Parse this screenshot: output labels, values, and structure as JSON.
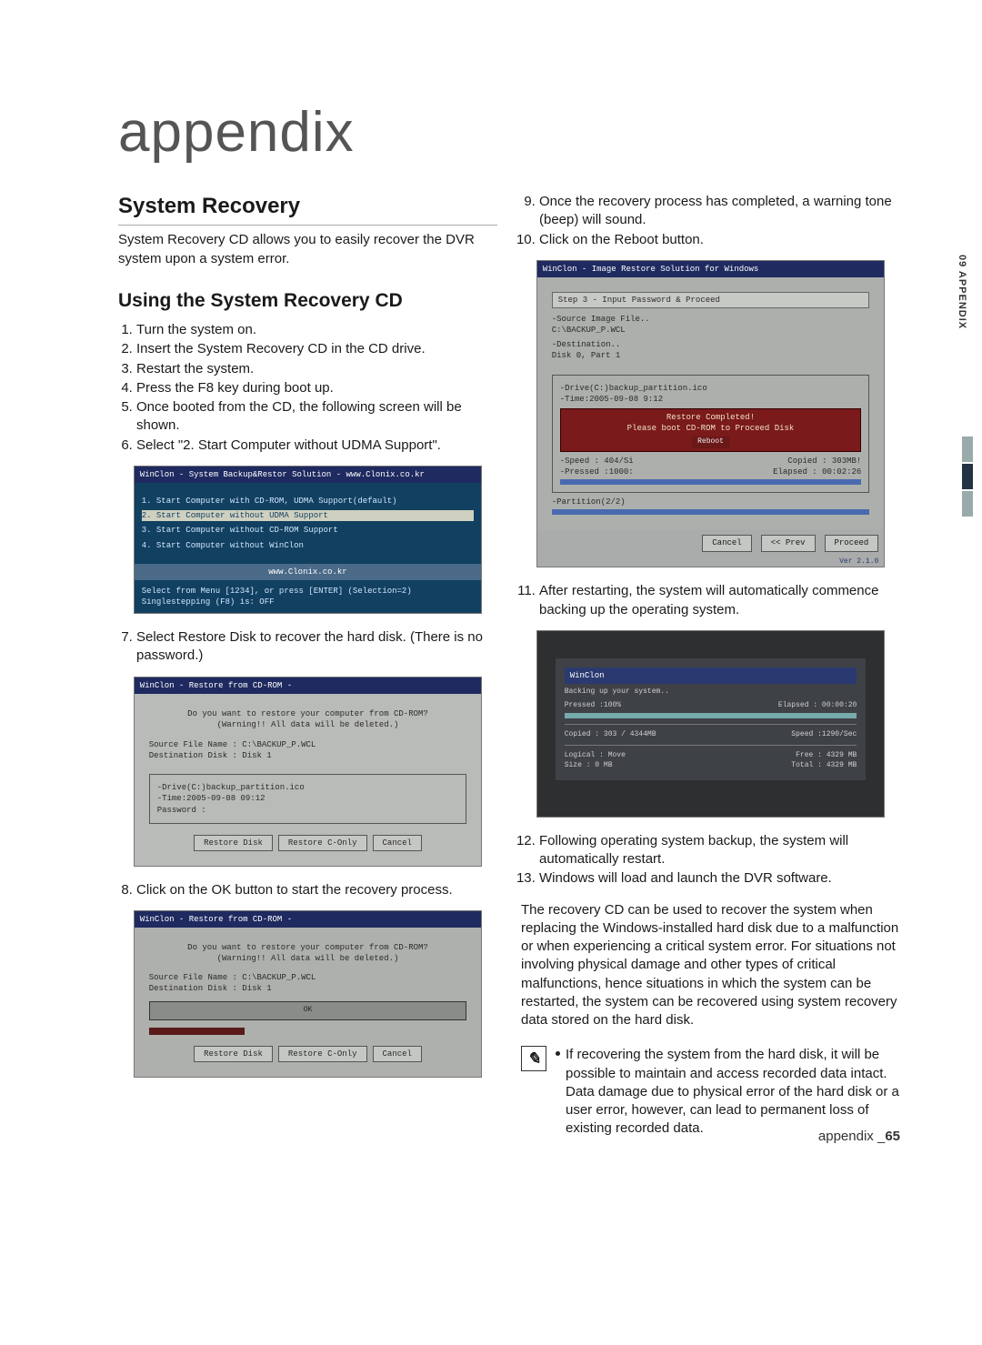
{
  "page": {
    "title": "appendix",
    "sidebar_label": "09 APPENDIX",
    "footer_word": "appendix _",
    "footer_page": "65"
  },
  "left": {
    "h_system_recovery": "System Recovery",
    "intro": "System Recovery CD allows you to easily recover the DVR system upon a system error.",
    "h_using": "Using the System Recovery CD",
    "steps_a": [
      "Turn the system on.",
      "Insert the System Recovery CD in the CD drive.",
      "Restart the system.",
      "Press the F8 key during boot up.",
      "Once booted from the CD, the following screen will be shown.",
      "Select \"2. Start Computer without UDMA Support\"."
    ],
    "shot1": {
      "title": "WinClon - System Backup&Restor Solution  -  www.Clonix.co.kr",
      "opts": [
        "1. Start Computer with CD-ROM, UDMA Support(default)",
        "2. Start Computer without UDMA Support",
        "3. Start Computer without CD-ROM Support",
        "4. Start Computer without WinClon"
      ],
      "url": "www.Clonix.co.kr",
      "sel1": "Select from Menu [1234], or press [ENTER] (Selection=2)",
      "sel2": "Singlestepping (F8) is: OFF"
    },
    "step7": "Select Restore Disk to recover the hard disk. (There is no password.)",
    "shot2": {
      "title": "WinClon - Restore from CD-ROM -",
      "msg1": "Do you want to restore your computer from CD-ROM?",
      "msg2": "(Warning!! All data will be deleted.)",
      "src": "Source File Name : C:\\BACKUP_P.WCL",
      "dst": "Destination Disk : Disk 1",
      "drv": "-Drive(C:)backup_partition.ico",
      "time": "-Time:2005-09-08 09:12",
      "pwd": "Password :",
      "btns": [
        "Restore Disk",
        "Restore C-Only",
        "Cancel"
      ]
    },
    "step8": "Click on the OK button to start the recovery process.",
    "shot3": {
      "title": "WinClon - Restore from CD-ROM -",
      "msg1": "Do you want to restore your computer from CD-ROM?",
      "msg2": "(Warning!! All data will be deleted.)",
      "src": "Source File Name : C:\\BACKUP_P.WCL",
      "dst": "Destination Disk : Disk 1",
      "btns": [
        "Restore Disk",
        "Restore C-Only",
        "Cancel"
      ]
    }
  },
  "right": {
    "steps_b": [
      "Once the recovery process has completed, a warning tone (beep) will sound.",
      "Click on the Reboot button."
    ],
    "shot4": {
      "title": "WinClon - Image Restore Solution for Windows",
      "step": "Step 3  -  Input Password & Proceed",
      "src1": "-Source Image File..",
      "src2": "  C:\\BACKUP_P.WCL",
      "dst1": "-Destination..",
      "dst2": "  Disk 0, Part 1",
      "drv": "-Drive(C:)backup_partition.ico",
      "time": "-Time:2005-09-08 9:12",
      "dlg_title": "Restore Completed!",
      "dlg_msg": "Please boot CD-ROM to Proceed Disk",
      "dlg_btn": "Reboot",
      "speed": "-Speed : 404/Si",
      "pressed": "-Pressed :1000:",
      "copied": "Copied : 303MB!",
      "elapsed": "Elapsed : 00:02:26",
      "part": "-Partition(2/2)",
      "botbtns": [
        "Cancel",
        "<< Prev",
        "Proceed"
      ],
      "ver": "Ver 2.1.0"
    },
    "step11": "After restarting, the system will automatically commence backing up the operating system.",
    "shot5": {
      "title": "WinClon",
      "line1": "Backing up your system..",
      "pressed": "Pressed :100%",
      "elapsed": "Elapsed : 00:00:20",
      "copied": "Copied : 303 / 4344MB",
      "speed": "Speed :1290/Sec",
      "logical": "Logical : Move",
      "size": "Size    : 0 MB",
      "free": "Free  : 4329 MB",
      "total": "Total : 4329 MB"
    },
    "steps_c": [
      "Following operating system backup, the system will automatically restart.",
      "Windows will load and launch the DVR software."
    ],
    "closing": "The recovery CD can be used to recover the system when replacing the Windows-installed hard disk due to a malfunction or when experiencing a critical system error. For situations not involving physical damage and other types of critical malfunctions, hence situations in which the system can be restarted, the system can be recovered using system recovery data stored on the hard disk.",
    "note": "If recovering the system from the hard disk, it will be possible to maintain and access recorded data intact. Data damage due to physical error of the hard disk or a user error, however, can lead to permanent loss of existing recorded data."
  }
}
